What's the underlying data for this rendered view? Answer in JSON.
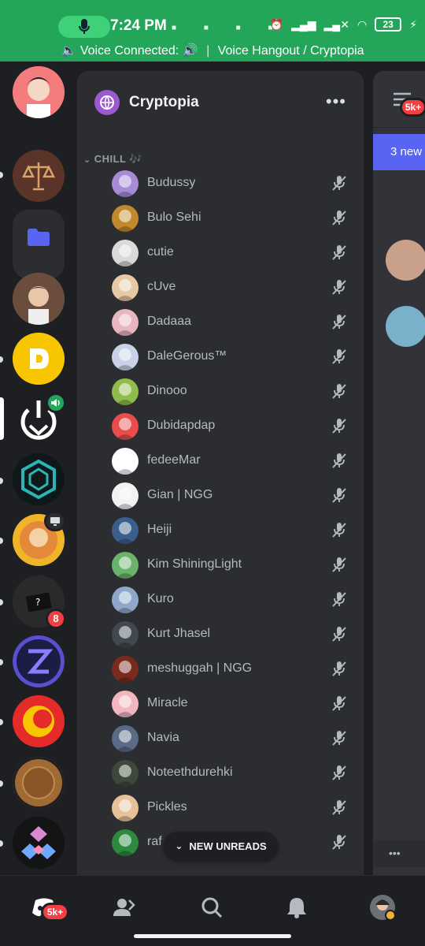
{
  "status_bar": {
    "time": "7:24 PM",
    "battery": "23",
    "voice_status": "Voice Connected:",
    "voice_channel": "Voice Hangout / Cryptopia"
  },
  "server": {
    "name": "Cryptopia",
    "category": "CHILL 🎶"
  },
  "members": [
    {
      "name": "Budussy",
      "color": "#a78bd4"
    },
    {
      "name": "Bulo Sehi",
      "color": "#c08a2c"
    },
    {
      "name": "cutie",
      "color": "#d9d9d9"
    },
    {
      "name": "cUve",
      "color": "#e7c9a6"
    },
    {
      "name": "Dadaaa",
      "color": "#e7b6c2"
    },
    {
      "name": "DaleGerous™",
      "color": "#c9d2e8"
    },
    {
      "name": "Dinooo",
      "color": "#8fbc4a"
    },
    {
      "name": "Dubidapdap",
      "color": "#e84c4c"
    },
    {
      "name": "fedeeMar",
      "color": "#ffffff"
    },
    {
      "name": "Gian | NGG",
      "color": "#f2f2f2"
    },
    {
      "name": "Heiji",
      "color": "#3b5f8c"
    },
    {
      "name": "Kim ShiningLight",
      "color": "#6bb36b"
    },
    {
      "name": "Kuro",
      "color": "#8fa8c9"
    },
    {
      "name": "Kurt Jhasel",
      "color": "#404850"
    },
    {
      "name": "meshuggah | NGG",
      "color": "#7a2b1e"
    },
    {
      "name": "Miracle",
      "color": "#f1b6c0"
    },
    {
      "name": "Navia",
      "color": "#5b6a86"
    },
    {
      "name": "Noteethdurehki",
      "color": "#3d4a3a"
    },
    {
      "name": "Pickles",
      "color": "#e6c199"
    },
    {
      "name": "raf",
      "color": "#2b8a3e"
    }
  ],
  "new_unreads_label": "NEW UNREADS",
  "right_panel": {
    "badge": "5k+",
    "banner": "3 new"
  },
  "guild_badges": {
    "unread_count": "8"
  },
  "bottom_nav": {
    "home_badge": "5k+"
  },
  "colors": {
    "status_green": "#23a55a",
    "blurple": "#5865f2",
    "red": "#f23f43"
  }
}
